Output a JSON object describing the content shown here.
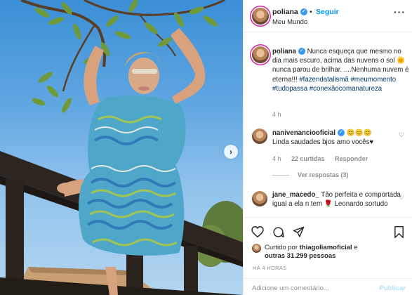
{
  "post": {
    "username": "poliana",
    "follow_label": "Seguir",
    "separator": "•",
    "location": "Meu Mundo",
    "more_label": "···"
  },
  "caption": {
    "username": "poliana",
    "text": " Nunca esqueça que mesmo no dia mais escuro, acima das nuvens o sol 🌞nunca parou de brilhar. ....Nenhuma nuvem é eterna!!! ",
    "hashtags": [
      "#fazendatalismã",
      "#meumomento",
      "#tudopassa",
      "#conexãocomanatureza"
    ],
    "time": "4 h"
  },
  "comments": [
    {
      "username": "nanivenanciooficial",
      "emojis": "😊😊😊",
      "text": "Linda saudades bjos amo vocês♥",
      "time": "4 h",
      "likes": "22 curtidas",
      "reply_label": "Responder",
      "view_replies": "Ver respostas (3)"
    },
    {
      "username": "jane_macedo_",
      "text": " Tão perfeita e comportada igual a ela n tem 🌹 Leonardo sortudo"
    }
  ],
  "likes_info": {
    "prefix": "Curtido por ",
    "user": "thiagoliamoficial",
    "middle": " e",
    "others": "outras 31.299 pessoas"
  },
  "posted_ago": "HÁ 4 HORAS",
  "comment_box": {
    "placeholder": "Adicione um comentário...",
    "publish_label": "Publicar"
  },
  "icons": {
    "verified": "verified-badge-icon",
    "like": "heart-icon",
    "comment": "comment-bubble-icon",
    "share": "paper-plane-icon",
    "save": "bookmark-icon",
    "next": "chevron-right-icon"
  },
  "colors": {
    "accent": "#0095f6",
    "verified": "#3897f0",
    "hashtag": "#00376b",
    "muted": "#8e8e8e"
  }
}
